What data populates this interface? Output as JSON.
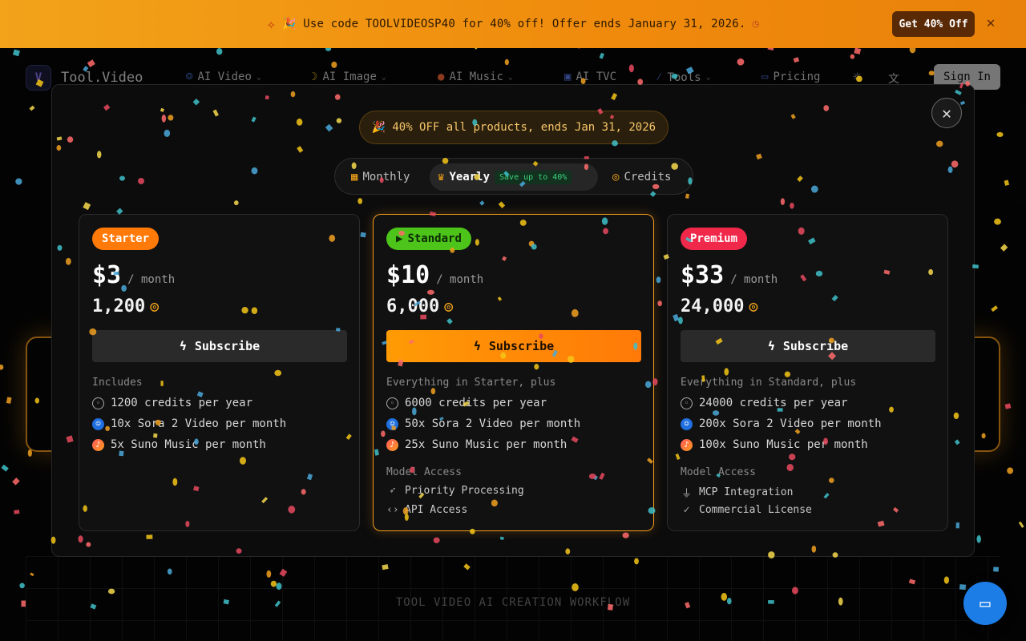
{
  "banner": {
    "text": "🎉 Use code TOOLVIDEOSP40 for 40% off! Offer ends January 31, 2026.",
    "button_label": "Get 40% Off",
    "close_icon": "close-icon"
  },
  "nav": {
    "brand": "Tool.Video",
    "items": [
      {
        "label": "AI Video",
        "icon": "robot-icon"
      },
      {
        "label": "AI Image",
        "icon": "banana-icon"
      },
      {
        "label": "AI Music",
        "icon": "music-icon"
      },
      {
        "label": "AI TVC",
        "icon": "film-icon"
      },
      {
        "label": "Tools",
        "icon": "wand-icon"
      },
      {
        "label": "Pricing",
        "icon": "card-icon"
      }
    ],
    "signin_label": "Sign In"
  },
  "modal": {
    "promo": "40% OFF all products, ends Jan 31, 2026",
    "tabs": [
      {
        "label": "Monthly",
        "icon": "calendar-icon"
      },
      {
        "label": "Yearly",
        "icon": "crown-icon",
        "badge": "Save up to 40%"
      },
      {
        "label": "Credits",
        "icon": "coins-icon"
      }
    ],
    "plans": [
      {
        "name": "Starter",
        "badge_color": "#ff7a08",
        "price": "$3",
        "per": "/ month",
        "credits": "1,200",
        "button": "Subscribe",
        "includes_label": "Includes",
        "features": [
          "1200 credits per year",
          "10x Sora 2 Video per month",
          "5x Suno Music per month"
        ]
      },
      {
        "name": "Standard",
        "badge_color": "#4cc419",
        "price": "$10",
        "per": "/ month",
        "credits": "6,000",
        "button": "Subscribe",
        "includes_label": "Everything in Starter, plus",
        "features": [
          "6000 credits per year",
          "50x Sora 2 Video per month",
          "25x Suno Music per month"
        ],
        "model_access_label": "Model Access",
        "extras": [
          "Priority Processing",
          "API Access"
        ]
      },
      {
        "name": "Premium",
        "badge_color": "#f0284a",
        "price": "$33",
        "per": "/ month",
        "credits": "24,000",
        "button": "Subscribe",
        "includes_label": "Everything in Standard, plus",
        "features": [
          "24000 credits per year",
          "200x Sora 2 Video per month",
          "100x Suno Music per month"
        ],
        "model_access_label": "Model Access",
        "extras": [
          "MCP Integration",
          "Commercial License"
        ]
      }
    ]
  },
  "workflow_title": "TOOL VIDEO AI CREATION WORKFLOW",
  "colors": {
    "accent": "#f39a1c",
    "banner": "#f08a0c"
  }
}
